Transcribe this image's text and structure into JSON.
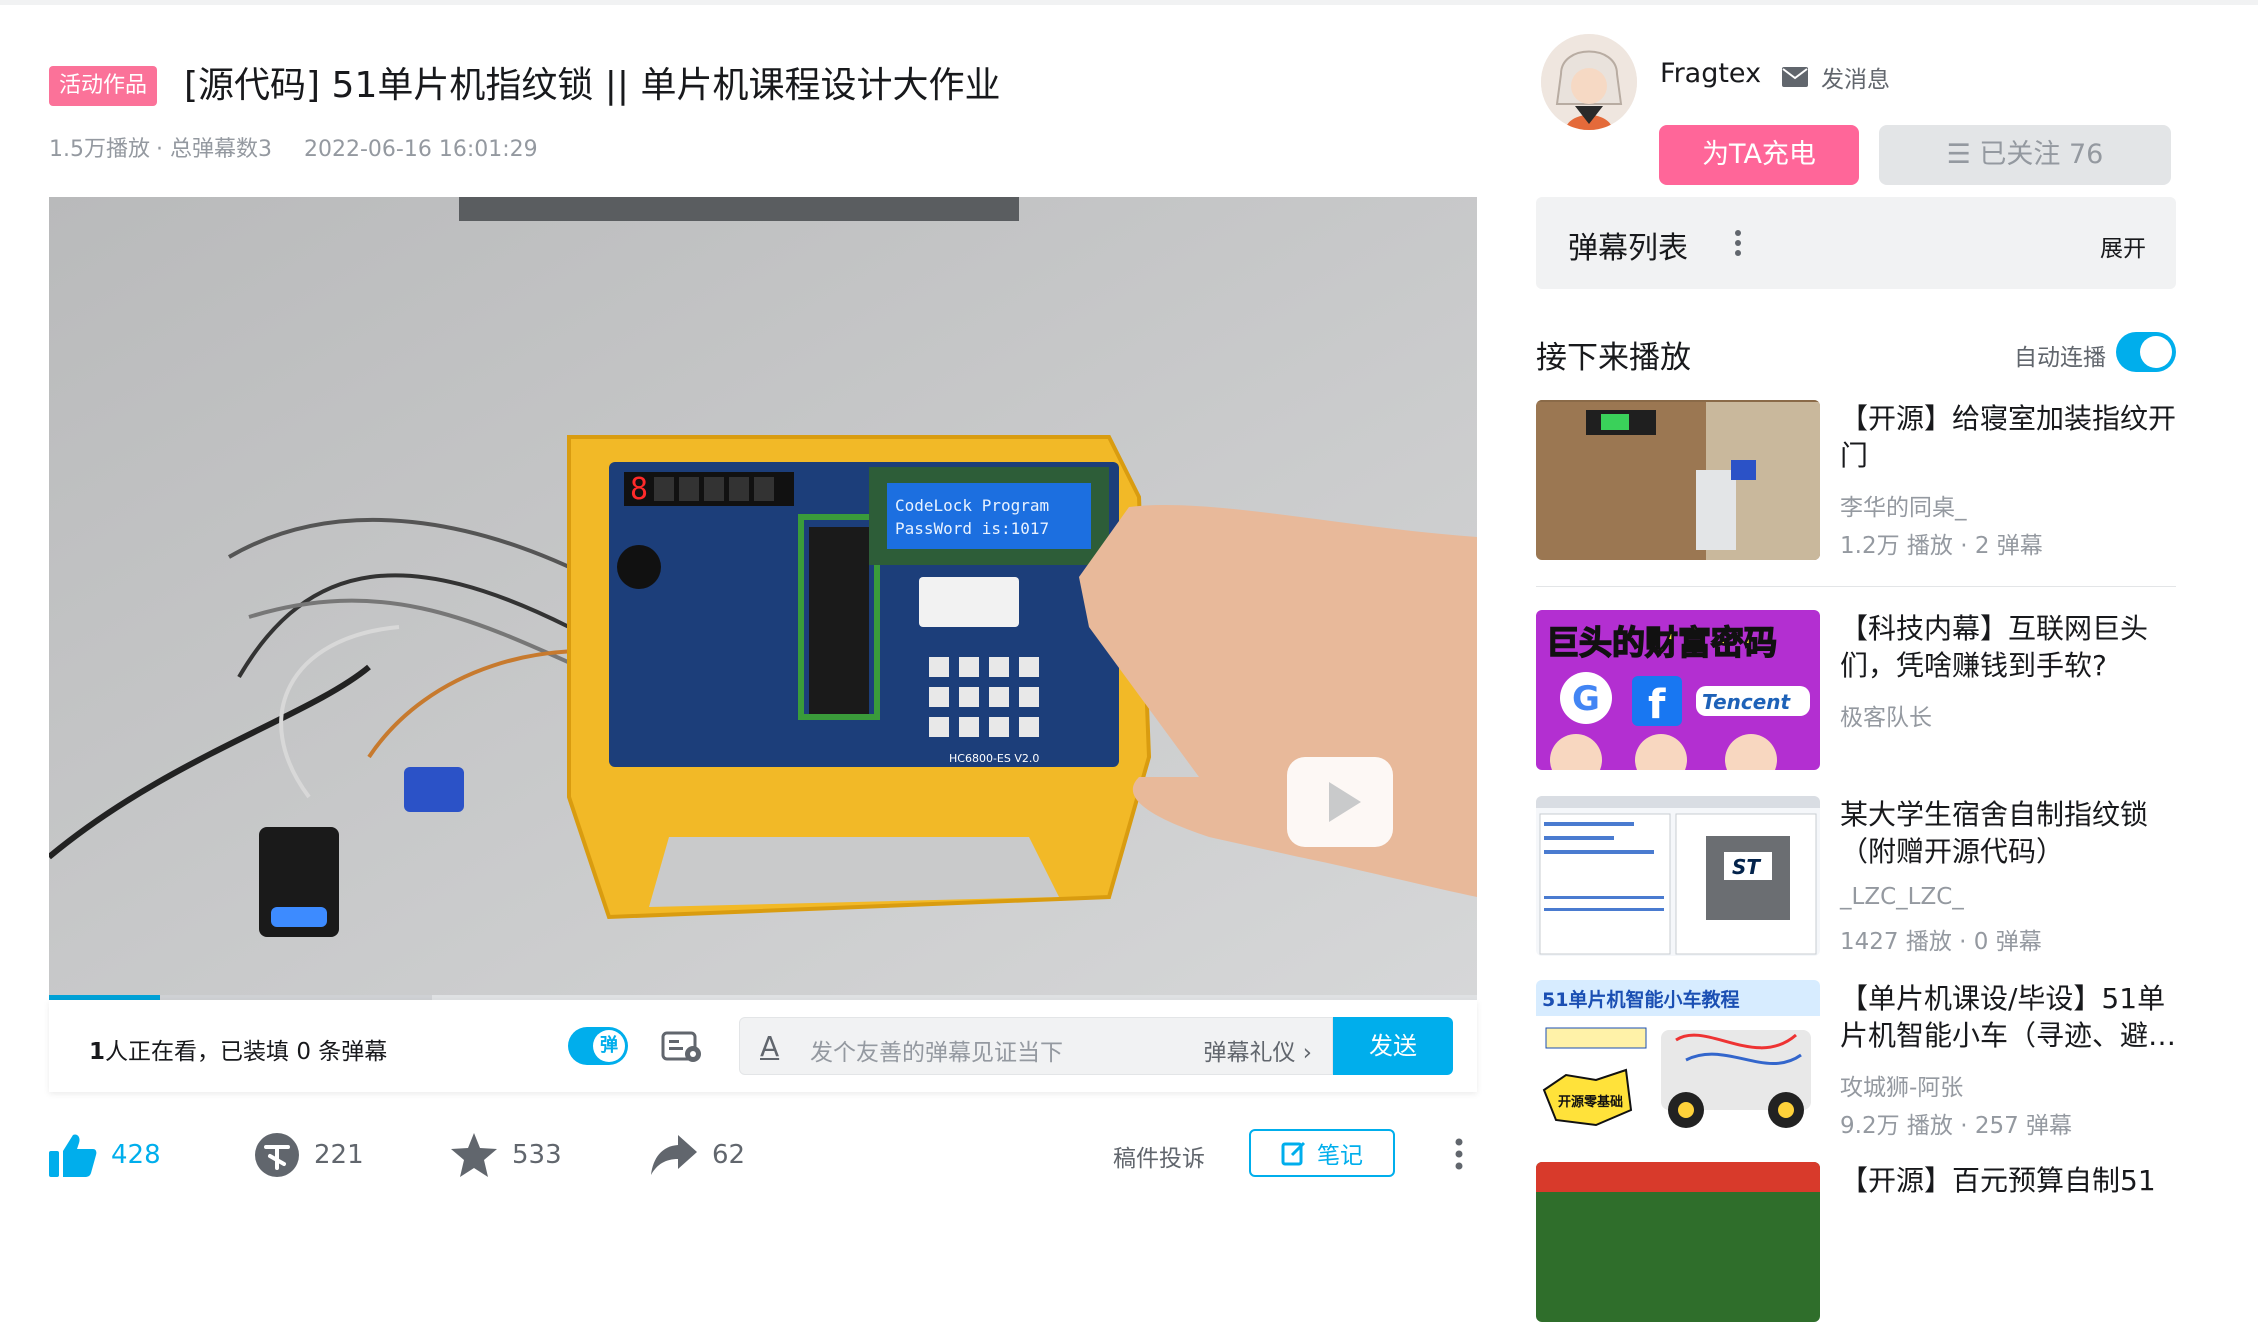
{
  "video": {
    "tag": "活动作品",
    "title": "[源代码] 51单片机指纹锁 || 单片机课程设计大作业",
    "plays": "1.5万播放",
    "danmaku_total": "· 总弹幕数3",
    "date": "2022-06-16 16:01:29",
    "screen_lcd_line1": "CodeLock Program",
    "screen_lcd_line2": "PassWord is:1017",
    "board_label": "HC6800-ES V2.0",
    "led_digit": "8"
  },
  "player": {
    "viewers_count": "1",
    "viewers_text": "人正在看，已装填 0 条弹幕",
    "danmaku_toggle_label": "弹",
    "input_placeholder": "发个友善的弹幕见证当下",
    "etiquette": "弹幕礼仪 ›",
    "send": "发送",
    "progress_played": 0.078,
    "progress_buffered": 0.268
  },
  "actions": {
    "like": "428",
    "coin": "221",
    "favorite": "533",
    "share": "62",
    "complaint": "稿件投诉",
    "note": "笔记"
  },
  "uploader": {
    "name": "Fragtex",
    "message": "发消息",
    "charge": "为TA充电",
    "follow": "☰ 已关注 76"
  },
  "danmaku_list": {
    "title": "弹幕列表",
    "expand": "展开"
  },
  "up_next": {
    "title": "接下来播放",
    "autoplay": "自动连播",
    "items": [
      {
        "title": "【开源】给寝室加装指纹开门",
        "author": "李华的同桌_",
        "stats": "1.2万 播放 · 2 弹幕"
      },
      {
        "title": "【科技内幕】互联网巨头们，凭啥赚钱到手软?",
        "author": "极客队长",
        "stats": "",
        "thumb_text": "巨头的财富密码",
        "thumb_logo": "Tencent"
      },
      {
        "title": "某大学生宿舍自制指纹锁（附赠开源代码）",
        "author": "_LZC_LZC_",
        "stats": "1427 播放 · 0 弹幕",
        "thumb_logo": "ST"
      },
      {
        "title": "【单片机课设/毕设】51单片机智能小车（寻迹、避…",
        "author": "攻城狮-阿张",
        "stats": "9.2万 播放 · 257 弹幕",
        "thumb_text": "51单片机智能小车教程",
        "thumb_badge": "开源零基础"
      },
      {
        "title": "【开源】百元预算自制51",
        "author": "",
        "stats": ""
      }
    ]
  },
  "colors": {
    "accent": "#00aeec",
    "pink": "#fb7299",
    "charge": "#ff6699"
  }
}
